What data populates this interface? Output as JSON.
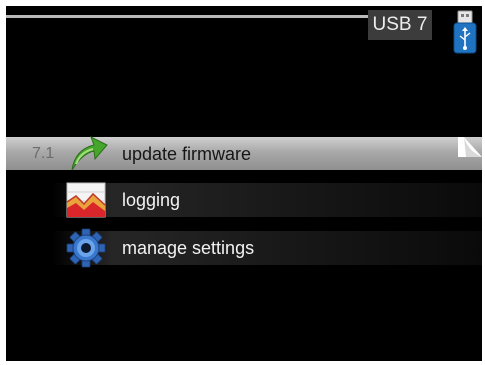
{
  "header": {
    "title": "USB 7",
    "usb_icon": "usb-stick-icon"
  },
  "menu": {
    "items": [
      {
        "number": "7.1",
        "label": "update firmware",
        "icon": "update-arrow-icon",
        "selected": true
      },
      {
        "label": "logging",
        "icon": "chart-icon",
        "selected": false
      },
      {
        "label": "manage settings",
        "icon": "gear-icon",
        "selected": false
      }
    ]
  },
  "colors": {
    "background": "#000000",
    "selected_row": "#b0b0b0",
    "title_box": "#3c3c3c",
    "usb_blue": "#1f73c0"
  }
}
